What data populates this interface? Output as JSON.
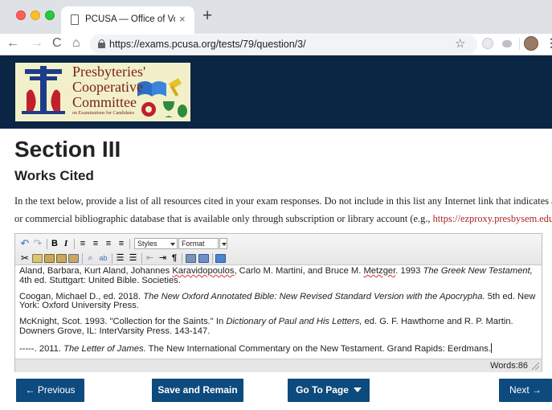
{
  "browser": {
    "tab_title": "PCUSA — Office of Vocation —",
    "tab_close": "×",
    "new_tab": "+",
    "url": "https://exams.pcusa.org/tests/79/question/3/",
    "back": "←",
    "forward": "→",
    "reload": "C",
    "home": "⌂",
    "bookmark": "☆",
    "menu": "⋮"
  },
  "header": {
    "logo_lines": [
      "Presbyteries'",
      "Cooperative",
      "Committee"
    ],
    "logo_subtitle": "on Examinations for Candidates",
    "colors": {
      "background": "#0b2545",
      "logo_bg": "#f2f0c9",
      "logo_text": "#7a1f1f"
    }
  },
  "page": {
    "section_title": "Section III",
    "subtitle": "Works Cited",
    "instructions_line1": "In the text below, provide a list of all resources cited in your exam responses. Do not include in this list any Internet link that indicates a library",
    "instructions_line2_prefix": "or commercial bibliographic database that is available only through subscription or library account (e.g., ",
    "instructions_link": "https://ezproxy.presbysem.edu\\",
    "instructions_line2_suffix": ")."
  },
  "editor": {
    "toolbar": {
      "bold": "B",
      "italic": "I",
      "styles_label": "Styles",
      "format_label": "Format",
      "pilcrow": "¶"
    },
    "citations": [
      {
        "a": "Aland, Barbara, Kurt Aland, Johannes ",
        "sp1": "Karavidopoulos",
        "b": ", Carlo M. Martini, and Bruce M. ",
        "sp2": "Metzger",
        "c": ". 1993 ",
        "i": "The Greek New Testament,",
        "d": " 4th ed. Stuttgart: United Bible. Societies."
      },
      {
        "a": "Coogan, Michael D., ed. 2018. ",
        "i": "The New Oxford Annotated Bible: New Revised Standard Version with the Apocrypha.",
        "d": " 5th ed. New York: Oxford University Press."
      },
      {
        "a": "McKnight, Scot. 1993. \"Collection for the Saints.\" In ",
        "i": "Dictionary of Paul and His Letters,",
        "d": " ed. G. F. Hawthorne and R. P. Martin. Downers Grove, IL: InterVarsity Press. 143-147."
      },
      {
        "a": "-----. 2011. ",
        "i": "The Letter of James.",
        "d": " The New International Commentary on the New Testament. Grand Rapids: Eerdmans."
      }
    ],
    "word_count": "Words:86"
  },
  "buttons": {
    "previous": "← Previous",
    "save": "Save and Remain",
    "goto": "Go To Page",
    "next": "Next →",
    "color": "#0d4a7d"
  }
}
